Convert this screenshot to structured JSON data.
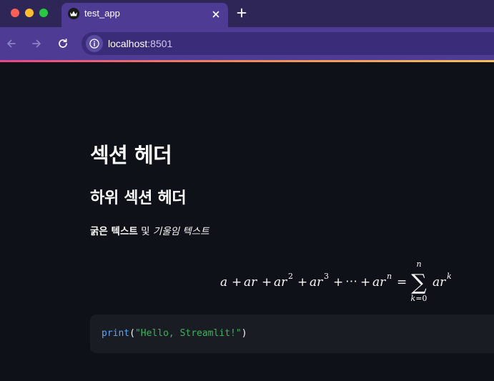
{
  "browser": {
    "tab_title": "test_app",
    "url_host": "localhost",
    "url_port": ":8501"
  },
  "page": {
    "header": "섹션 헤더",
    "subheader": "하위 섹션 헤더",
    "bold_text": "굵은 텍스트",
    "connector_text": " 및 ",
    "italic_text": "기울임 텍스트",
    "code": {
      "func": "print",
      "open_paren": "(",
      "string": "\"Hello, Streamlit!\"",
      "close_paren": ")"
    }
  },
  "icons": {
    "favicon": "crown-icon",
    "close_tab": "close-icon",
    "new_tab": "plus-icon",
    "back": "arrow-left-icon",
    "forward": "arrow-right-icon",
    "reload": "reload-icon",
    "site_info": "info-icon"
  },
  "colors": {
    "tab_active": "#4d3b94",
    "tab_bar": "#2e2657",
    "page_bg": "#0e1117",
    "code_bg": "#1a1c24",
    "code_keyword": "#5aa4f2",
    "code_string": "#3cb35c"
  }
}
